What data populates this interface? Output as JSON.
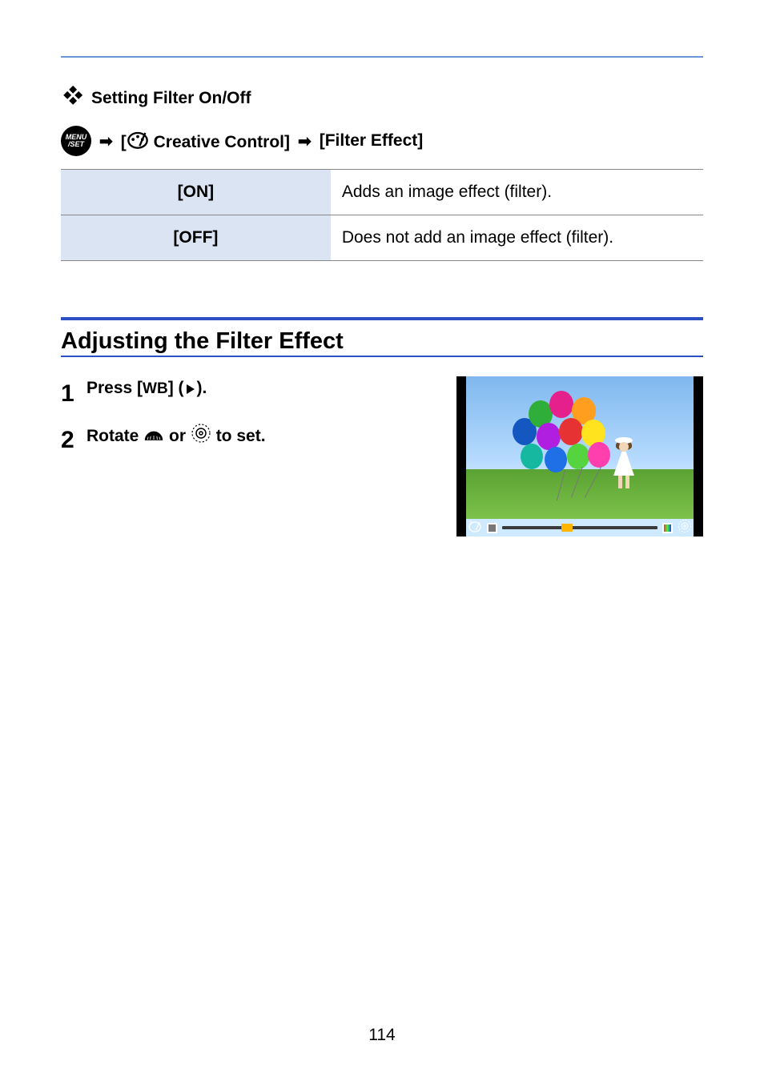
{
  "section1": {
    "subtitle": "Setting Filter On/Off",
    "menu_prefix": "[",
    "menu_creative": "Creative Control]",
    "menu_arrow_sep": "→",
    "menu_item": "[Filter Effect]",
    "table": [
      {
        "key": "[ON]",
        "val": "Adds an image effect (filter)."
      },
      {
        "key": "[OFF]",
        "val": "Does not add an image effect (filter)."
      }
    ]
  },
  "section2": {
    "heading": "Adjusting the Filter Effect",
    "step1_num": "1",
    "step1_a": "Press [",
    "step1_wb": "WB",
    "step1_b": "] (",
    "step1_c": ").",
    "step2_num": "2",
    "step2_a": "Rotate ",
    "step2_or": " or ",
    "step2_b": " to set.",
    "icon_names": {
      "wb": "WB",
      "triangle": "►"
    }
  },
  "page_number": "114"
}
